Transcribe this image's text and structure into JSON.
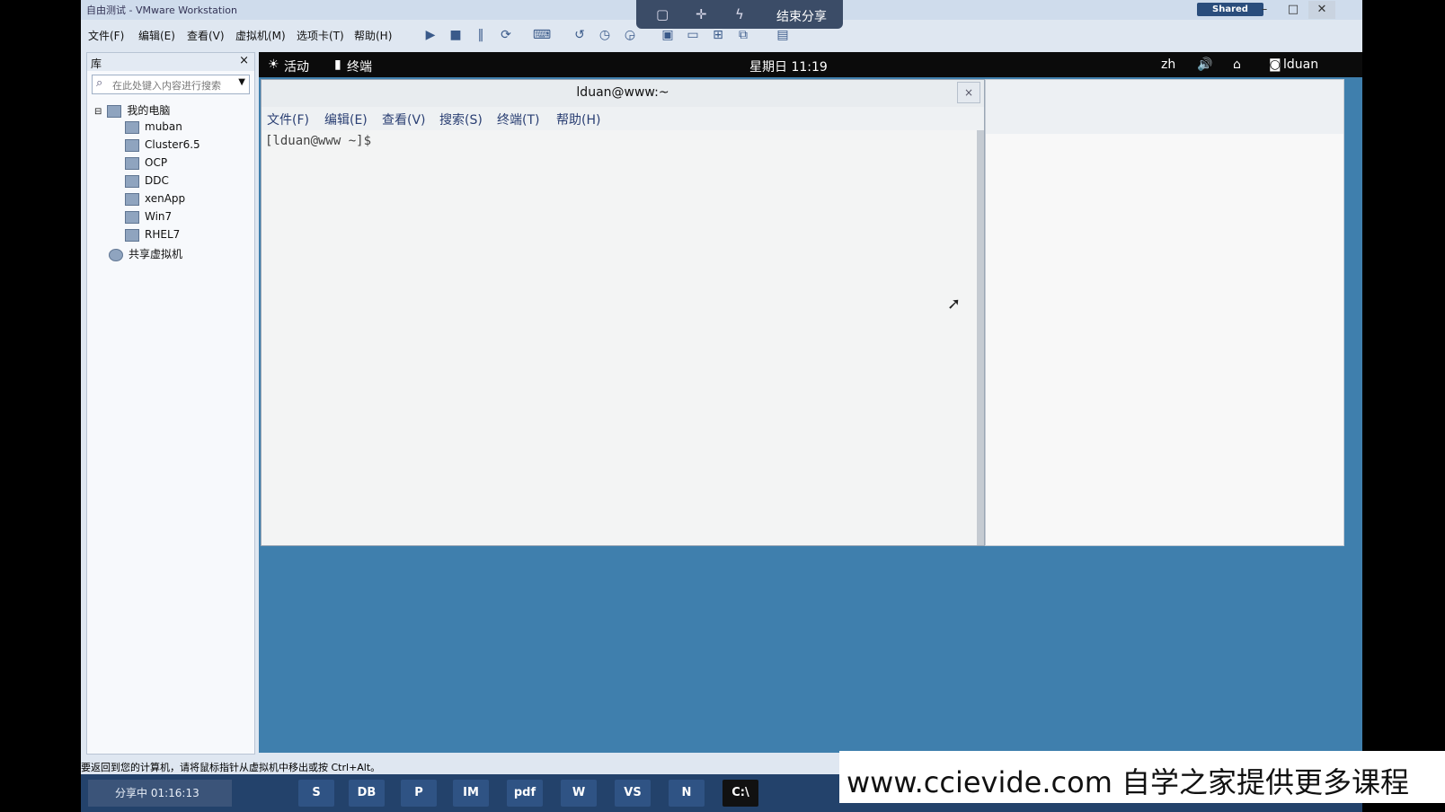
{
  "vmware": {
    "title": "自由测试 - VMware Workstation",
    "shared_badge": "Shared",
    "menu": [
      "文件(F)",
      "编辑(E)",
      "查看(V)",
      "虚拟机(M)",
      "选项卡(T)",
      "帮助(H)"
    ],
    "toolbar_icons": [
      "play-icon",
      "stop-icon",
      "pause-icon",
      "refresh-icon",
      "send-keys-icon",
      "snapshot-icon",
      "revert-icon",
      "manage-snapshot-icon",
      "view-console-icon",
      "fullscreen-icon",
      "unity-icon",
      "thumbnail-icon",
      "library-icon"
    ]
  },
  "share_overlay": {
    "icons": [
      "square-icon",
      "crosshair-icon",
      "lightning-icon"
    ],
    "label": "结束分享"
  },
  "library": {
    "title": "库",
    "close": "×",
    "search_placeholder": "在此处键入内容进行搜索",
    "root": "我的电脑",
    "items": [
      "muban",
      "Cluster6.5",
      "OCP",
      "DDC",
      "xenApp",
      "Win7",
      "RHEL7"
    ],
    "shared": "共享虚拟机"
  },
  "guest": {
    "activities": "活动",
    "app": "终端",
    "clock": "星期日 11:19",
    "lang": "zh",
    "user": "lduan",
    "terminal": {
      "title": "lduan@www:~",
      "close": "×",
      "menu": [
        "文件(F)",
        "编辑(E)",
        "查看(V)",
        "搜索(S)",
        "终端(T)",
        "帮助(H)"
      ],
      "prompt": "[lduan@www ~]$"
    }
  },
  "status": "要返回到您的计算机，请将鼠标指针从虚拟机中移出或按 Ctrl+Alt。",
  "taskbar": {
    "share_time": "分享中 01:16:13",
    "apps": [
      "S",
      "DB",
      "P",
      "IM",
      "pdf",
      "W",
      "VS",
      "N",
      "C:\\"
    ]
  },
  "watermark": "www.ccievide.com 自学之家提供更多课程"
}
